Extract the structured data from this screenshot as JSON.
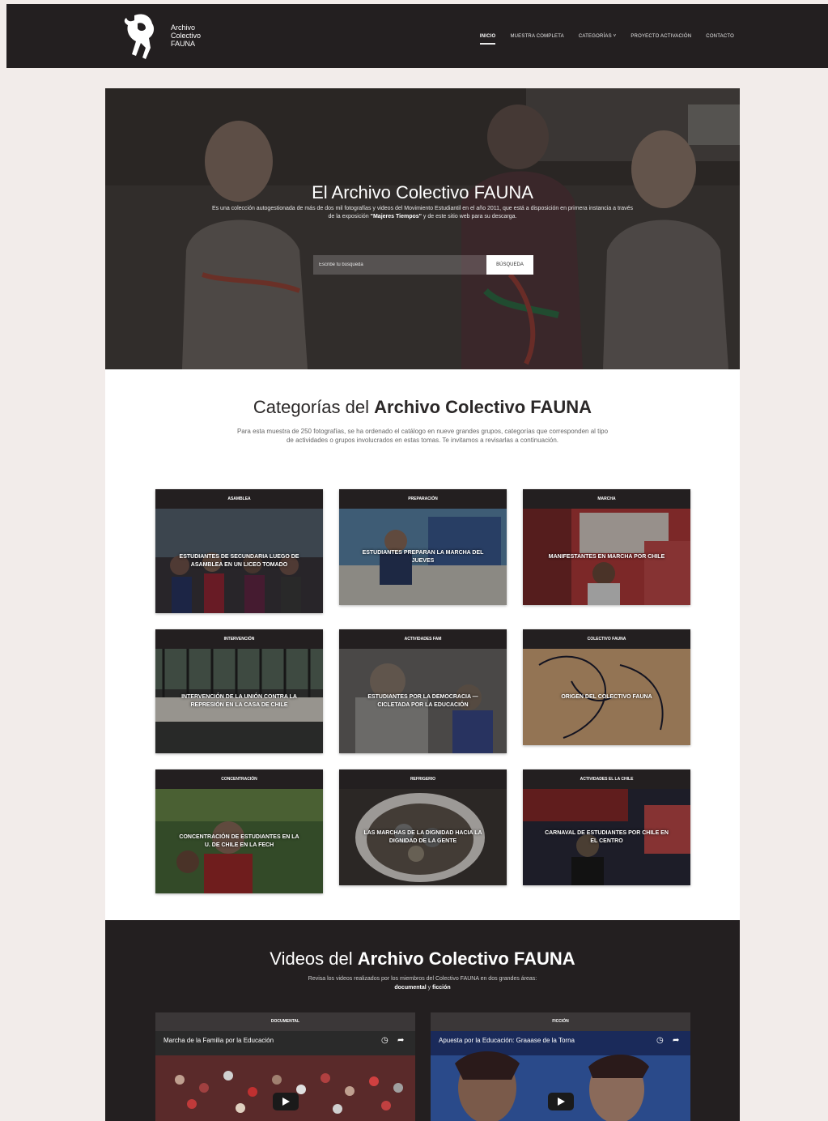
{
  "brand": {
    "logo_name": "fauna-logo-figure",
    "line1": "Archivo",
    "line2": "Colectivo",
    "line3": "FAUNA"
  },
  "nav": {
    "items": [
      {
        "label": "INICIO",
        "active": true
      },
      {
        "label": "MUESTRA COMPLETA",
        "active": false
      },
      {
        "label": "CATEGORÍAS ˅",
        "active": false
      },
      {
        "label": "PROYECTO ACTIVACIÓN",
        "active": false
      },
      {
        "label": "CONTACTO",
        "active": false
      }
    ]
  },
  "hero": {
    "title": "El Archivo Colectivo FAUNA",
    "description_start": "Es una colección autogestionada de más de dos mil fotografías y videos del Movimiento Estudiantil en el año 2011, que está a disposición en primera instancia a través de la exposición",
    "description_bold": "\"Majeres Tiempos\"",
    "description_end": "y de este sitio web para su descarga.",
    "search_placeholder": "Escribe tu búsqueda",
    "search_button": "BÚSQUEDA"
  },
  "categories": {
    "title_normal": "Categorías del ",
    "title_bold": "Archivo Colectivo FAUNA",
    "description": "Para esta muestra de 250 fotografías, se ha ordenado el catálogo en nueve grandes grupos, categorías que corresponden al tipo de actividades o grupos involucrados en estas tomas. Te invitamos a revisarlas a continuación.",
    "cards": [
      {
        "header": "ASAMBLEA",
        "label": "ESTUDIANTES DE SECUNDARIA LUEGO DE ASAMBLEA EN UN LICEO TOMADO"
      },
      {
        "header": "PREPARACIÓN",
        "label": "ESTUDIANTES PREPARAN LA MARCHA DEL JUEVES"
      },
      {
        "header": "MARCHA",
        "label": "MANIFESTANTES EN MARCHA POR CHILE"
      },
      {
        "header": "INTERVENCIÓN",
        "label": "INTERVENCIÓN DE LA UNIÓN CONTRA LA REPRESIÓN EN LA CASA DE CHILE"
      },
      {
        "header": "ACTIVIDADES FAM",
        "label": "ESTUDIANTES POR LA DEMOCRACIA — CICLETADA POR LA EDUCACIÓN"
      },
      {
        "header": "COLECTIVO FAUNA",
        "label": "ORIGEN DEL COLECTIVO FAUNA"
      },
      {
        "header": "CONCENTRACIÓN",
        "label": "CONCENTRACIÓN DE ESTUDIANTES EN LA U. DE CHILE EN LA FECH"
      },
      {
        "header": "REFRIGERIO",
        "label": "LAS MARCHAS DE LA DIGNIDAD HACIA LA DIGNIDAD DE LA GENTE"
      },
      {
        "header": "ACTIVIDADES EL LA CHILE",
        "label": "CARNAVAL DE ESTUDIANTES POR CHILE EN EL CENTRO"
      }
    ]
  },
  "videos": {
    "title_normal": "Videos del ",
    "title_bold": "Archivo Colectivo FAUNA",
    "description_start": "Revisa los videos realizados por los miembros del Colectivo FAUNA en dos grandes áreas:",
    "description_bold1": "documental",
    "description_mid": " y ",
    "description_bold2": "ficción",
    "columns": [
      {
        "header": "DOCUMENTAL",
        "title": "Marcha de la Familia por la Educación"
      },
      {
        "header": "FICCIÓN",
        "title": "Apuesta por la Educación: Graaase de la Torna"
      }
    ]
  },
  "colors": {
    "dark": "#231f20",
    "page_bg": "#f2ecea",
    "card_bg": "#ffffff"
  }
}
